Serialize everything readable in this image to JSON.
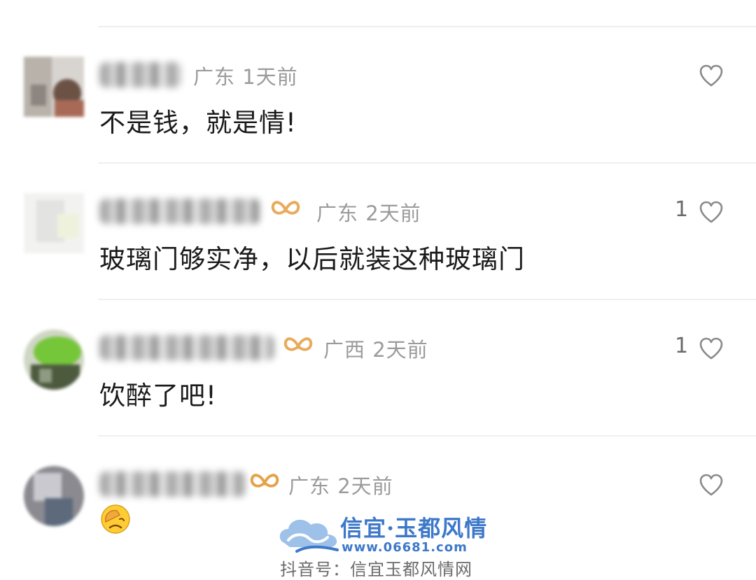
{
  "comments": [
    {
      "location": "广东",
      "time": "1天前",
      "text": "不是钱，就是情!",
      "like_count": ""
    },
    {
      "location": "广东",
      "time": "2天前",
      "text": "玻璃门够实净，以后就装这种玻璃门",
      "like_count": "1"
    },
    {
      "location": "广西",
      "time": "2天前",
      "text": "饮醉了吧!",
      "like_count": "1"
    },
    {
      "location": "广东",
      "time": "2天前",
      "text": "",
      "like_count": "",
      "emoji": "facepalm-emoji"
    }
  ],
  "watermark": {
    "brand": "信宜·玉都风情",
    "url": "www.06681.com",
    "douyin": "抖音号：信宜玉都风情网"
  },
  "colors": {
    "meta_text": "#9b9b9b",
    "comment_text": "#1a1a1a",
    "divider": "#efefef",
    "watermark_blue": "#3d78c9",
    "badge_gold": "#e6a24a"
  }
}
